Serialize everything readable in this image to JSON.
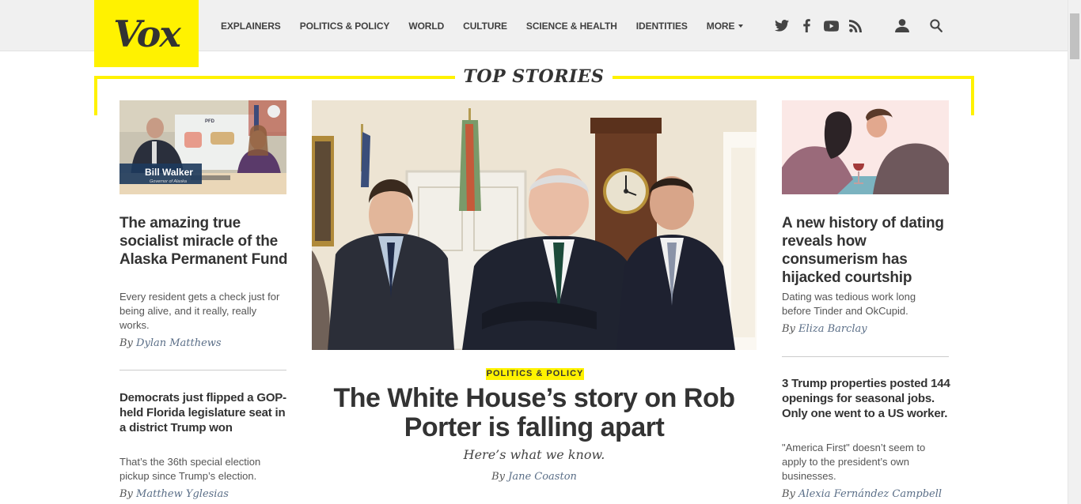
{
  "brand": {
    "logo_text": "Vox",
    "accent": "#fff200"
  },
  "nav": {
    "items": [
      "EXPLAINERS",
      "POLITICS & POLICY",
      "WORLD",
      "CULTURE",
      "SCIENCE & HEALTH",
      "IDENTITIES"
    ],
    "more_label": "MORE"
  },
  "header_icons": [
    "twitter-icon",
    "facebook-icon",
    "youtube-icon",
    "rss-icon",
    "user-icon",
    "search-icon"
  ],
  "section_title": "TOP STORIES",
  "left_column": [
    {
      "image_caption_name": "Bill Walker",
      "image_caption_title": "Governor of Alaska",
      "image_chart_label": "PFD",
      "headline": "The amazing true socialist miracle of the Alaska Permanent Fund",
      "dek": "Every resident gets a check just for being alive, and it really, really works.",
      "by": "By",
      "author": "Dylan Matthews"
    },
    {
      "headline": "Democrats just flipped a GOP-held Florida legislature seat in a district Trump won",
      "dek": "That’s the 36th special election pickup since Trump’s election.",
      "by": "By",
      "author": "Matthew Yglesias"
    }
  ],
  "main_story": {
    "category": "POLITICS & POLICY",
    "headline": "The White House’s story on Rob Porter is falling apart",
    "dek": "Here’s what we know.",
    "by": "By",
    "author": "Jane Coaston"
  },
  "right_column": [
    {
      "headline": "A new history of dating reveals how consumerism has hijacked courtship",
      "dek": "Dating was tedious work long before Tinder and OkCupid.",
      "by": "By",
      "author": "Eliza Barclay"
    },
    {
      "headline": "3 Trump properties posted 144 openings for seasonal jobs. Only one went to a US worker.",
      "dek": "\"America First\" doesn’t seem to apply to the president’s own businesses.",
      "by": "By",
      "author": "Alexia Fernández Campbell"
    }
  ]
}
